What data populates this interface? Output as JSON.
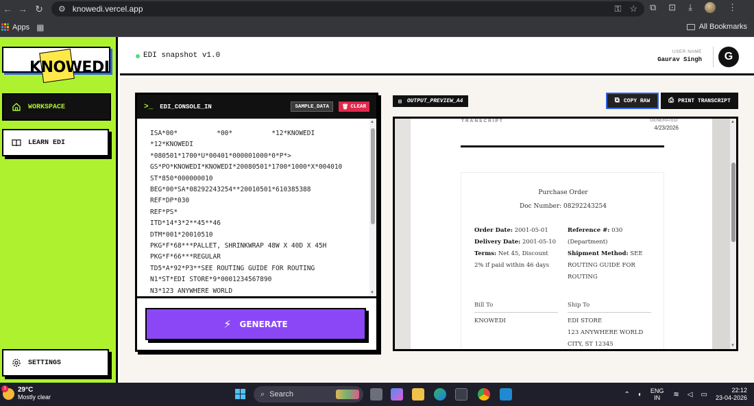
{
  "browser": {
    "url": "knowedi.vercel.app",
    "bookmarks": {
      "apps_label": "Apps",
      "all_bookmarks_label": "All Bookmarks"
    }
  },
  "sidebar": {
    "logo_text": "KNOWEDI",
    "items": [
      {
        "label": "WORKSPACE",
        "icon": "home-icon"
      },
      {
        "label": "LEARN EDI",
        "icon": "book-icon"
      },
      {
        "label": "SETTINGS",
        "icon": "gear-icon"
      }
    ]
  },
  "header": {
    "title": "EDI snapshot v1.0",
    "user_label": "USER NAME",
    "user_name": "Gaurav Singh",
    "avatar_letter": "G"
  },
  "console": {
    "title": "EDI_CONSOLE_IN",
    "sample_button": "SAMPLE_DATA",
    "clear_button": "CLEAR",
    "text": "ISA*00*          *00*          *12*KNOWEDI\n*12*KNOWEDI\n*080501*1700*U*00401*000001000*0*P*>\nGS*PO*KNOWEDI*KNOWEDI*20080501*1700*1000*X*004010\nST*850*000000010\nBEG*00*SA*08292243254**20010501*610385388\nREF*DP*030\nREF*PS*\nITD*14*3*2**45**46\nDTM*001*20010510\nPKG*F*68***PALLET, SHRINKWRAP 48W X 40D X 45H\nPKG*F*66***REGULAR\nTD5*A*92*P3**SEE ROUTING GUIDE FOR ROUTING\nN1*ST*EDI STORE*9*0001234567890\nN3*123 ANYWHERE WORLD",
    "generate_button": "GENERATE"
  },
  "output": {
    "tag": "OUTPUT_PREVIEW_A4",
    "copy_button": "COPY RAW",
    "print_button": "PRINT TRANSCRIPT",
    "transcript_label": "TRANSCRIPT",
    "generated_label": "GENERATED:",
    "generated_date": "4/23/2026",
    "doc_title": "Purchase Order",
    "doc_number": "Doc Number: 08292243254",
    "order_date_label": "Order Date:",
    "order_date": "2001-05-01",
    "delivery_date_label": "Delivery Date:",
    "delivery_date": "2001-05-10",
    "terms_label": "Terms:",
    "terms_1": "Net 45, Discount",
    "terms_2": "2% if paid within 46 days",
    "reference_label": "Reference #:",
    "reference": "030",
    "reference_note": "(Department)",
    "shipment_label": "Shipment Method:",
    "shipment_1": "SEE",
    "shipment_2": "ROUTING GUIDE FOR",
    "shipment_3": "ROUTING",
    "bill_to_label": "Bill To",
    "bill_to": "KNOWEDI",
    "ship_to_label": "Ship To",
    "ship_to_1": "EDI STORE",
    "ship_to_2": "123 ANYWHERE WORLD",
    "ship_to_3": "CITY, ST 12345"
  },
  "taskbar": {
    "temperature": "29°C",
    "weather": "Mostly clear",
    "weather_badge": "3",
    "search_label": "Search",
    "lang_1": "ENG",
    "lang_2": "IN",
    "time": "22:12",
    "date": "23-04-2026"
  },
  "colors": {
    "sidebar_bg": "#aef22f",
    "generate_bg": "#8b47f5",
    "clear_red": "#e0294b",
    "accent_blue": "#2f66e8"
  }
}
